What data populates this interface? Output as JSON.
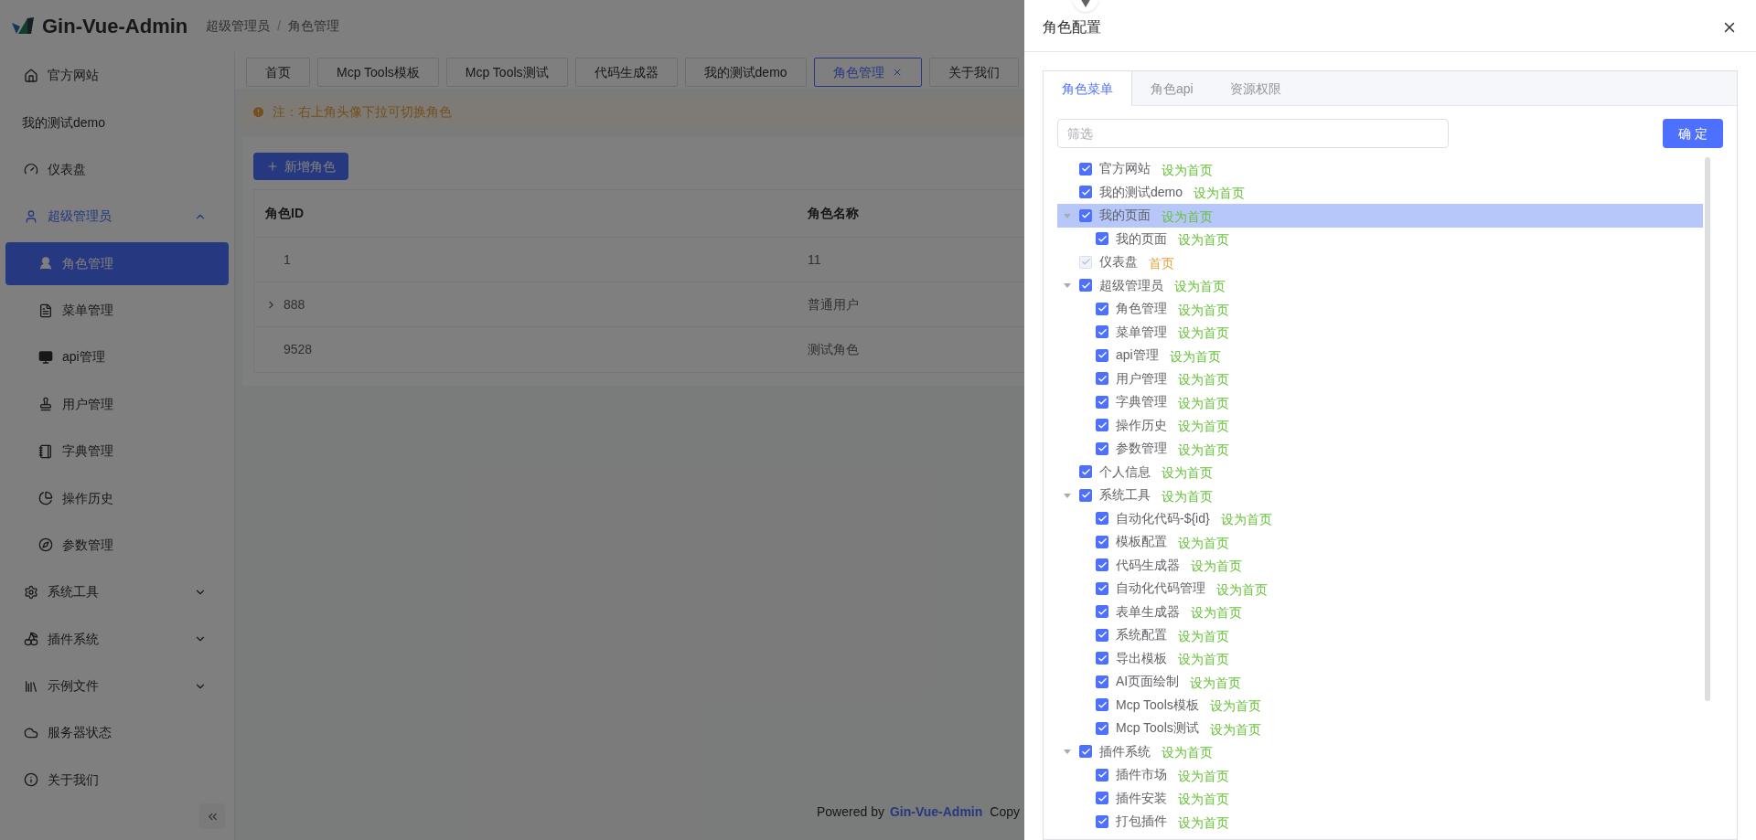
{
  "header": {
    "logo_text": "Gin-Vue-Admin",
    "breadcrumb": [
      "超级管理员",
      "角色管理"
    ],
    "breadcrumb_separator": "/"
  },
  "sidebar": {
    "items": [
      {
        "label": "官方网站",
        "selected": false
      },
      {
        "label": "我的测试demo",
        "selected": false
      },
      {
        "label": "仪表盘",
        "selected": false
      },
      {
        "label": "超级管理员",
        "selected": false,
        "expanded": true,
        "children": [
          {
            "label": "角色管理",
            "selected": true
          },
          {
            "label": "菜单管理",
            "selected": false
          },
          {
            "label": "api管理",
            "selected": false
          },
          {
            "label": "用户管理",
            "selected": false
          },
          {
            "label": "字典管理",
            "selected": false
          },
          {
            "label": "操作历史",
            "selected": false
          },
          {
            "label": "参数管理",
            "selected": false
          }
        ]
      },
      {
        "label": "系统工具",
        "selected": false,
        "expanded": false
      },
      {
        "label": "插件系统",
        "selected": false,
        "expanded": false
      },
      {
        "label": "示例文件",
        "selected": false,
        "expanded": false
      },
      {
        "label": "服务器状态",
        "selected": false
      },
      {
        "label": "关于我们",
        "selected": false
      }
    ]
  },
  "tabs": [
    {
      "label": "首页",
      "selected": false,
      "closable": false
    },
    {
      "label": "Mcp Tools模板",
      "selected": false,
      "closable": false
    },
    {
      "label": "Mcp Tools测试",
      "selected": false,
      "closable": false
    },
    {
      "label": "代码生成器",
      "selected": false,
      "closable": false
    },
    {
      "label": "我的测试demo",
      "selected": false,
      "closable": false
    },
    {
      "label": "角色管理",
      "selected": true,
      "closable": true
    },
    {
      "label": "关于我们",
      "selected": false,
      "closable": false
    }
  ],
  "alert": {
    "text": "注：右上角头像下拉可切换角色"
  },
  "add_button": "新增角色",
  "table": {
    "columns": [
      "角色ID",
      "角色名称"
    ],
    "rows": [
      {
        "cells": [
          "1",
          "11"
        ],
        "expandable": false
      },
      {
        "cells": [
          "888",
          "普通用户"
        ],
        "expandable": true
      },
      {
        "cells": [
          "9528",
          "测试角色"
        ],
        "expandable": false
      }
    ]
  },
  "footer": {
    "prefix": "Powered by",
    "link": "Gin-Vue-Admin",
    "suffix": "Copy"
  },
  "drawer": {
    "title": "角色配置",
    "tabs": [
      {
        "label": "角色菜单",
        "selected": true
      },
      {
        "label": "角色api",
        "selected": false
      },
      {
        "label": "资源权限",
        "selected": false
      }
    ],
    "filter_placeholder": "筛选",
    "confirm": "确 定",
    "tree": [
      {
        "label": "官方网站",
        "link": "设为首页",
        "is_home": false,
        "checked": true,
        "disabled": false,
        "selected": false
      },
      {
        "label": "我的测试demo",
        "link": "设为首页",
        "is_home": false,
        "checked": true,
        "disabled": false,
        "selected": false
      },
      {
        "label": "我的页面",
        "link": "设为首页",
        "is_home": false,
        "checked": true,
        "disabled": false,
        "selected": true,
        "expanded": true,
        "children": [
          {
            "label": "我的页面",
            "link": "设为首页",
            "is_home": false,
            "checked": true,
            "disabled": false,
            "selected": false
          }
        ]
      },
      {
        "label": "仪表盘",
        "link": "首页",
        "is_home": true,
        "checked": true,
        "disabled": true,
        "selected": false
      },
      {
        "label": "超级管理员",
        "link": "设为首页",
        "is_home": false,
        "checked": true,
        "disabled": false,
        "selected": false,
        "expanded": true,
        "children": [
          {
            "label": "角色管理",
            "link": "设为首页",
            "is_home": false,
            "checked": true,
            "disabled": false,
            "selected": false
          },
          {
            "label": "菜单管理",
            "link": "设为首页",
            "is_home": false,
            "checked": true,
            "disabled": false,
            "selected": false
          },
          {
            "label": "api管理",
            "link": "设为首页",
            "is_home": false,
            "checked": true,
            "disabled": false,
            "selected": false
          },
          {
            "label": "用户管理",
            "link": "设为首页",
            "is_home": false,
            "checked": true,
            "disabled": false,
            "selected": false
          },
          {
            "label": "字典管理",
            "link": "设为首页",
            "is_home": false,
            "checked": true,
            "disabled": false,
            "selected": false
          },
          {
            "label": "操作历史",
            "link": "设为首页",
            "is_home": false,
            "checked": true,
            "disabled": false,
            "selected": false
          },
          {
            "label": "参数管理",
            "link": "设为首页",
            "is_home": false,
            "checked": true,
            "disabled": false,
            "selected": false
          }
        ]
      },
      {
        "label": "个人信息",
        "link": "设为首页",
        "is_home": false,
        "checked": true,
        "disabled": false,
        "selected": false
      },
      {
        "label": "系统工具",
        "link": "设为首页",
        "is_home": false,
        "checked": true,
        "disabled": false,
        "selected": false,
        "expanded": true,
        "children": [
          {
            "label": "自动化代码-${id}",
            "link": "设为首页",
            "is_home": false,
            "checked": true,
            "disabled": false,
            "selected": false
          },
          {
            "label": "模板配置",
            "link": "设为首页",
            "is_home": false,
            "checked": true,
            "disabled": false,
            "selected": false
          },
          {
            "label": "代码生成器",
            "link": "设为首页",
            "is_home": false,
            "checked": true,
            "disabled": false,
            "selected": false
          },
          {
            "label": "自动化代码管理",
            "link": "设为首页",
            "is_home": false,
            "checked": true,
            "disabled": false,
            "selected": false
          },
          {
            "label": "表单生成器",
            "link": "设为首页",
            "is_home": false,
            "checked": true,
            "disabled": false,
            "selected": false
          },
          {
            "label": "系统配置",
            "link": "设为首页",
            "is_home": false,
            "checked": true,
            "disabled": false,
            "selected": false
          },
          {
            "label": "导出模板",
            "link": "设为首页",
            "is_home": false,
            "checked": true,
            "disabled": false,
            "selected": false
          },
          {
            "label": "AI页面绘制",
            "link": "设为首页",
            "is_home": false,
            "checked": true,
            "disabled": false,
            "selected": false
          },
          {
            "label": "Mcp Tools模板",
            "link": "设为首页",
            "is_home": false,
            "checked": true,
            "disabled": false,
            "selected": false
          },
          {
            "label": "Mcp Tools测试",
            "link": "设为首页",
            "is_home": false,
            "checked": true,
            "disabled": false,
            "selected": false
          }
        ]
      },
      {
        "label": "插件系统",
        "link": "设为首页",
        "is_home": false,
        "checked": true,
        "disabled": false,
        "selected": false,
        "expanded": true,
        "children": [
          {
            "label": "插件市场",
            "link": "设为首页",
            "is_home": false,
            "checked": true,
            "disabled": false,
            "selected": false
          },
          {
            "label": "插件安装",
            "link": "设为首页",
            "is_home": false,
            "checked": true,
            "disabled": false,
            "selected": false
          },
          {
            "label": "打包插件",
            "link": "设为首页",
            "is_home": false,
            "checked": true,
            "disabled": false,
            "selected": false
          }
        ]
      }
    ]
  }
}
